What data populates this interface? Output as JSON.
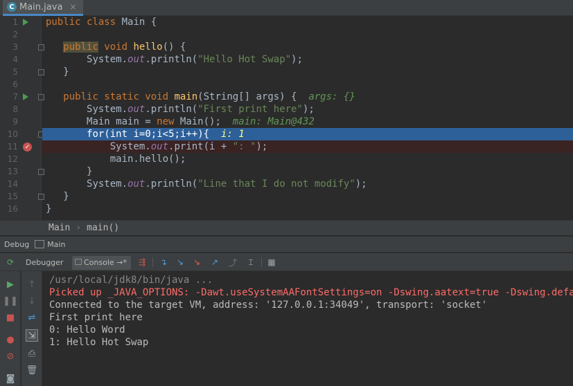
{
  "tab": {
    "filename": "Main.java",
    "close": "×"
  },
  "gutter": {
    "line_numbers": [
      "1",
      "2",
      "3",
      "4",
      "5",
      "6",
      "7",
      "8",
      "9",
      "10",
      "11",
      "12",
      "13",
      "14",
      "15",
      "16"
    ]
  },
  "code": {
    "l1": {
      "kw": "public class",
      "rest": " Main {"
    },
    "l3": {
      "kw1": "public",
      "kw2": " void ",
      "fn": "hello",
      "rest": "() {"
    },
    "l4": {
      "a": "System.",
      "it": "out",
      "b": ".println(",
      "str": "\"Hello Hot Swap\"",
      "c": ");"
    },
    "l5": "}",
    "l7": {
      "kw": "public static void ",
      "fn": "main",
      "rest": "(String[] args) {  ",
      "hint": "args: {}"
    },
    "l8": {
      "a": "System.",
      "it": "out",
      "b": ".println(",
      "str": "\"First print here\"",
      "c": ");"
    },
    "l9": {
      "a": "Main main = ",
      "kw": "new",
      "b": " Main();  ",
      "hint": "main: Main@432"
    },
    "l10": {
      "kw": "for",
      "a": "(",
      "kw2": "int",
      "b": " i=",
      "n1": "0",
      "c": ";i<",
      "n2": "5",
      "d": ";i++){  ",
      "hint": "i: 1"
    },
    "l11": {
      "a": "System.",
      "it": "out",
      "b": ".print(i + ",
      "str": "\": \"",
      "c": ");"
    },
    "l12": "main.hello();",
    "l13": "}",
    "l14": {
      "a": "System.",
      "it": "out",
      "b": ".println(",
      "str": "\"Line that I do not modify\"",
      "c": ");"
    },
    "l15": "}",
    "l16": "}"
  },
  "breadcrumb": {
    "class": "Main",
    "sep": "›",
    "method": "main()"
  },
  "debug": {
    "label": "Debug",
    "config": "Main"
  },
  "debug_tabs": {
    "debugger": "Debugger",
    "console": "Console",
    "console_pin": "→*"
  },
  "console": {
    "lines": [
      "/usr/local/jdk8/bin/java ...",
      "Picked up _JAVA_OPTIONS: -Dawt.useSystemAAFontSettings=on -Dswing.aatext=true -Dswing.defaultlaf=com.sun.java.swing.plaf.gtk.GTKLookAndFeel",
      "Connected to the target VM, address: '127.0.0.1:34049', transport: 'socket'",
      "First print here",
      "0: Hello Word",
      "1: Hello Hot Swap"
    ]
  },
  "colors": {
    "execution_line": "#2d6099",
    "breakpoint": "#c75450",
    "run_green": "#499c54",
    "error_text": "#ff6b68"
  }
}
